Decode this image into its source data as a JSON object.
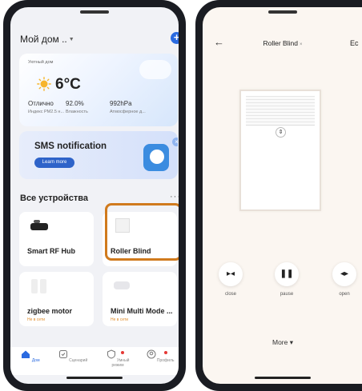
{
  "left_screen": {
    "home_title": "Мой дом ..",
    "add_button": "+",
    "weather": {
      "label": "Уютный дом",
      "temperature": "6°C",
      "stats": [
        {
          "value": "Отлично",
          "label": "Индекс PM2.5 н..."
        },
        {
          "value": "92.0%",
          "label": "Влажность"
        },
        {
          "value": "992hPa",
          "label": "Атмосферное д..."
        }
      ]
    },
    "banner": {
      "title": "SMS notification",
      "button": "Learn more"
    },
    "devices_title": "Все устройства",
    "devices_more": "···",
    "devices": [
      {
        "name": "Smart RF Hub",
        "status": ""
      },
      {
        "name": "Roller Blind",
        "status": ""
      },
      {
        "name": "zigbee motor",
        "status": "Не в сети"
      },
      {
        "name": "Mini Multi Mode ...",
        "status": "Не в сети"
      }
    ],
    "tabs": [
      {
        "label": "Дом",
        "icon": "home-icon"
      },
      {
        "label": "Сценарий",
        "icon": "scenario-icon"
      },
      {
        "label": "Умный режим",
        "icon": "smart-mode-icon"
      },
      {
        "label": "Профиль",
        "icon": "profile-icon"
      }
    ],
    "accent_color": "#2a6ae0",
    "highlight_color": "#d07a1d"
  },
  "right_screen": {
    "title": "Roller Blind",
    "title_badge": "×",
    "edit": "Ec",
    "controls": [
      {
        "label": "close",
        "icon": "close-curtain-icon"
      },
      {
        "label": "pause",
        "icon": "pause-icon"
      },
      {
        "label": "open",
        "icon": "open-curtain-icon"
      }
    ],
    "more": "More ▾"
  }
}
